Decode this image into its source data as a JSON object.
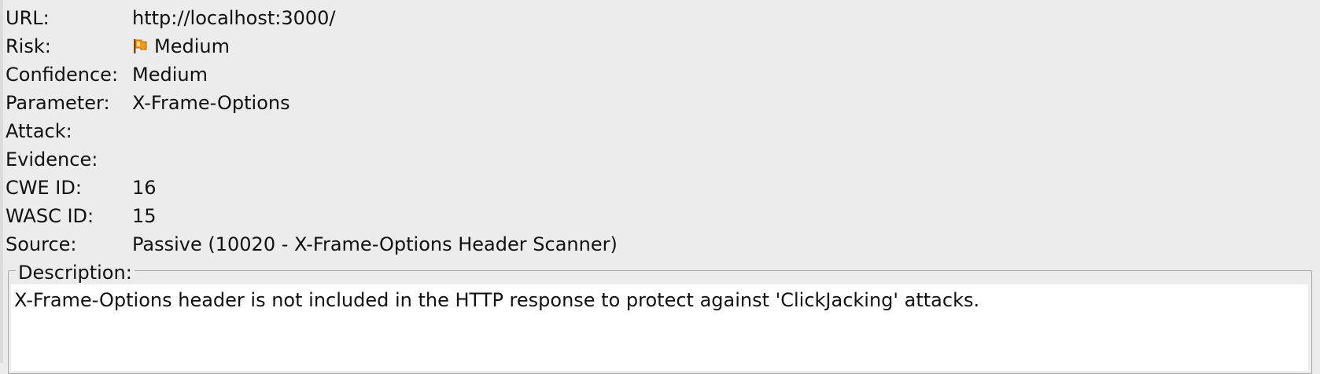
{
  "alert": {
    "url": {
      "label": "URL:",
      "value": "http://localhost:3000/"
    },
    "risk": {
      "label": "Risk:",
      "value": "Medium",
      "icon": "orange-flag-icon",
      "icon_color": "#f39c12"
    },
    "confidence": {
      "label": "Confidence:",
      "value": "Medium"
    },
    "parameter": {
      "label": "Parameter:",
      "value": "X-Frame-Options"
    },
    "attack": {
      "label": "Attack:",
      "value": ""
    },
    "evidence": {
      "label": "Evidence:",
      "value": ""
    },
    "cwe": {
      "label": "CWE ID:",
      "value": "16"
    },
    "wasc": {
      "label": "WASC ID:",
      "value": "15"
    },
    "source": {
      "label": "Source:",
      "value": "Passive (10020 - X-Frame-Options Header Scanner)"
    }
  },
  "description": {
    "legend": "Description:",
    "text": "X-Frame-Options header is not included in the HTTP response to protect against 'ClickJacking' attacks."
  },
  "colors": {
    "panel_background": "#ececec",
    "text_area_background": "#ffffff",
    "risk_flag": "#f39c12"
  }
}
